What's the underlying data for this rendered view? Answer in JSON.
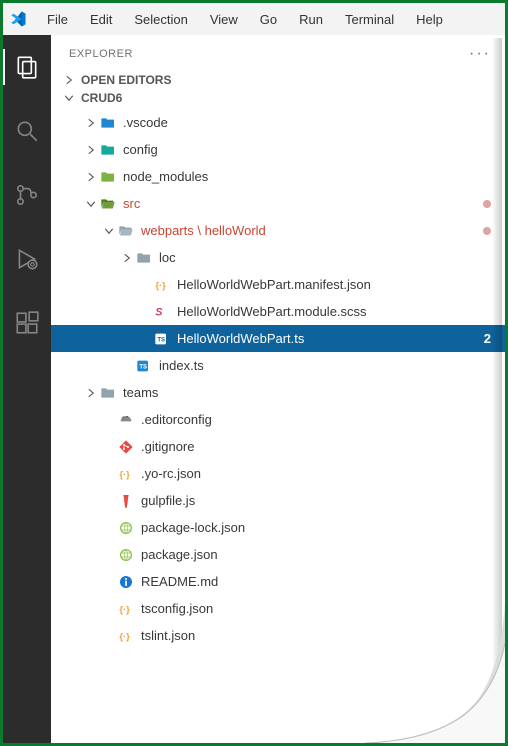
{
  "menubar": {
    "items": [
      "File",
      "Edit",
      "Selection",
      "View",
      "Go",
      "Run",
      "Terminal",
      "Help"
    ]
  },
  "activitybar": {
    "items": [
      {
        "name": "explorer-icon",
        "active": true
      },
      {
        "name": "search-icon",
        "active": false
      },
      {
        "name": "source-control-icon",
        "active": false
      },
      {
        "name": "run-debug-icon",
        "active": false
      },
      {
        "name": "extensions-icon",
        "active": false
      }
    ]
  },
  "explorer": {
    "title": "EXPLORER",
    "openEditors": "OPEN EDITORS",
    "project": "CRUD6",
    "tree": [
      {
        "depth": 1,
        "chev": "right",
        "icon": "folder-vscode",
        "label": ".vscode"
      },
      {
        "depth": 1,
        "chev": "right",
        "icon": "folder-config",
        "label": "config"
      },
      {
        "depth": 1,
        "chev": "right",
        "icon": "folder-node",
        "label": "node_modules"
      },
      {
        "depth": 1,
        "chev": "down",
        "icon": "folder-src",
        "label": "src",
        "modified": true,
        "dot": true
      },
      {
        "depth": 2,
        "chev": "down",
        "icon": "folder-open",
        "label": "webparts \\ helloWorld",
        "modified": true,
        "dot": true
      },
      {
        "depth": 3,
        "chev": "right",
        "icon": "folder",
        "label": "loc"
      },
      {
        "depth": 4,
        "chev": "",
        "icon": "json",
        "label": "HelloWorldWebPart.manifest.json"
      },
      {
        "depth": 4,
        "chev": "",
        "icon": "scss",
        "label": "HelloWorldWebPart.module.scss"
      },
      {
        "depth": 4,
        "chev": "",
        "icon": "ts",
        "label": "HelloWorldWebPart.ts",
        "selected": true,
        "badge": "2"
      },
      {
        "depth": 3,
        "chev": "",
        "icon": "ts",
        "label": "index.ts"
      },
      {
        "depth": 1,
        "chev": "right",
        "icon": "folder",
        "label": "teams"
      },
      {
        "depth": 2,
        "chev": "",
        "icon": "editorconfig",
        "label": ".editorconfig"
      },
      {
        "depth": 2,
        "chev": "",
        "icon": "git",
        "label": ".gitignore"
      },
      {
        "depth": 2,
        "chev": "",
        "icon": "json",
        "label": ".yo-rc.json"
      },
      {
        "depth": 2,
        "chev": "",
        "icon": "gulp",
        "label": "gulpfile.js"
      },
      {
        "depth": 2,
        "chev": "",
        "icon": "npm",
        "label": "package-lock.json"
      },
      {
        "depth": 2,
        "chev": "",
        "icon": "npm",
        "label": "package.json"
      },
      {
        "depth": 2,
        "chev": "",
        "icon": "info",
        "label": "README.md"
      },
      {
        "depth": 2,
        "chev": "",
        "icon": "json",
        "label": "tsconfig.json"
      },
      {
        "depth": 2,
        "chev": "",
        "icon": "json",
        "label": "tslint.json"
      }
    ]
  }
}
